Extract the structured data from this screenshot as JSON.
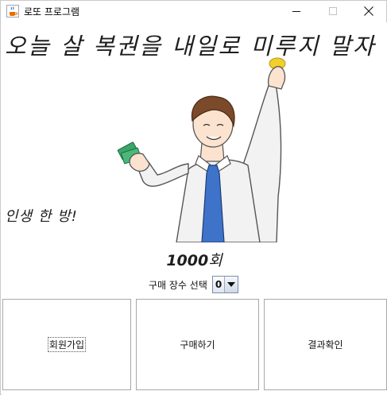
{
  "window": {
    "title": "로또 프로그램"
  },
  "main": {
    "headline": "오늘 살 복권을 내일로 미루지 말자",
    "slogan": "인생 한 방!",
    "round_number": "1000",
    "round_suffix": "회",
    "quantity_label": "구매 장수 선택",
    "quantity_value": "0"
  },
  "buttons": {
    "join_label": "회원가입",
    "buy_label": "구매하기",
    "result_label": "결과확인"
  },
  "icons": {
    "app": "java-coffee-icon",
    "minimize": "minimize-icon",
    "maximize": "maximize-icon",
    "close": "close-icon",
    "dropdown": "chevron-down-icon"
  },
  "colors": {
    "shirt": "#f2f2f2",
    "tie": "#3f73c9",
    "hair": "#7a4a2a",
    "money": "#3aa66a",
    "coin": "#f2cf2a"
  }
}
